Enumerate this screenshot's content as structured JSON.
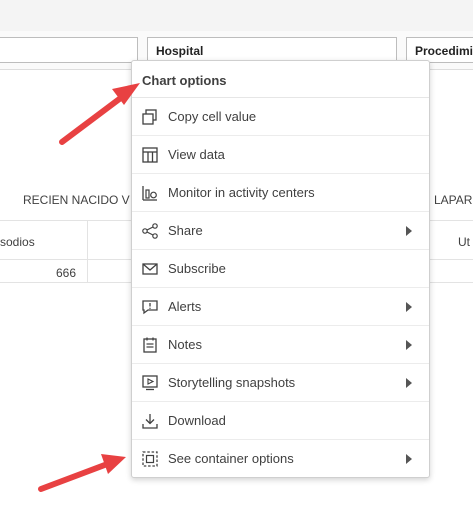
{
  "filters": {
    "hospital_label": "Hospital",
    "procedimiento_label": "Procedimi"
  },
  "table": {
    "left_header_1": "RECIEN NACIDO V",
    "right_header_1": "LAPAR",
    "left_header_2": "sodios",
    "right_header_2": "Ut",
    "value_1": "666"
  },
  "menu": {
    "title": "Chart options",
    "items": [
      {
        "label": "Copy cell value",
        "icon": "copy-icon",
        "submenu": false
      },
      {
        "label": "View data",
        "icon": "table-icon",
        "submenu": false
      },
      {
        "label": "Monitor in activity centers",
        "icon": "monitor-icon",
        "submenu": false
      },
      {
        "label": "Share",
        "icon": "share-icon",
        "submenu": true
      },
      {
        "label": "Subscribe",
        "icon": "envelope-icon",
        "submenu": false
      },
      {
        "label": "Alerts",
        "icon": "alert-icon",
        "submenu": true
      },
      {
        "label": "Notes",
        "icon": "notes-icon",
        "submenu": true
      },
      {
        "label": "Storytelling snapshots",
        "icon": "snapshot-icon",
        "submenu": true
      },
      {
        "label": "Download",
        "icon": "download-icon",
        "submenu": false
      },
      {
        "label": "See container options",
        "icon": "container-icon",
        "submenu": true
      }
    ]
  },
  "annotation": {
    "arrow_color": "#e84142"
  }
}
